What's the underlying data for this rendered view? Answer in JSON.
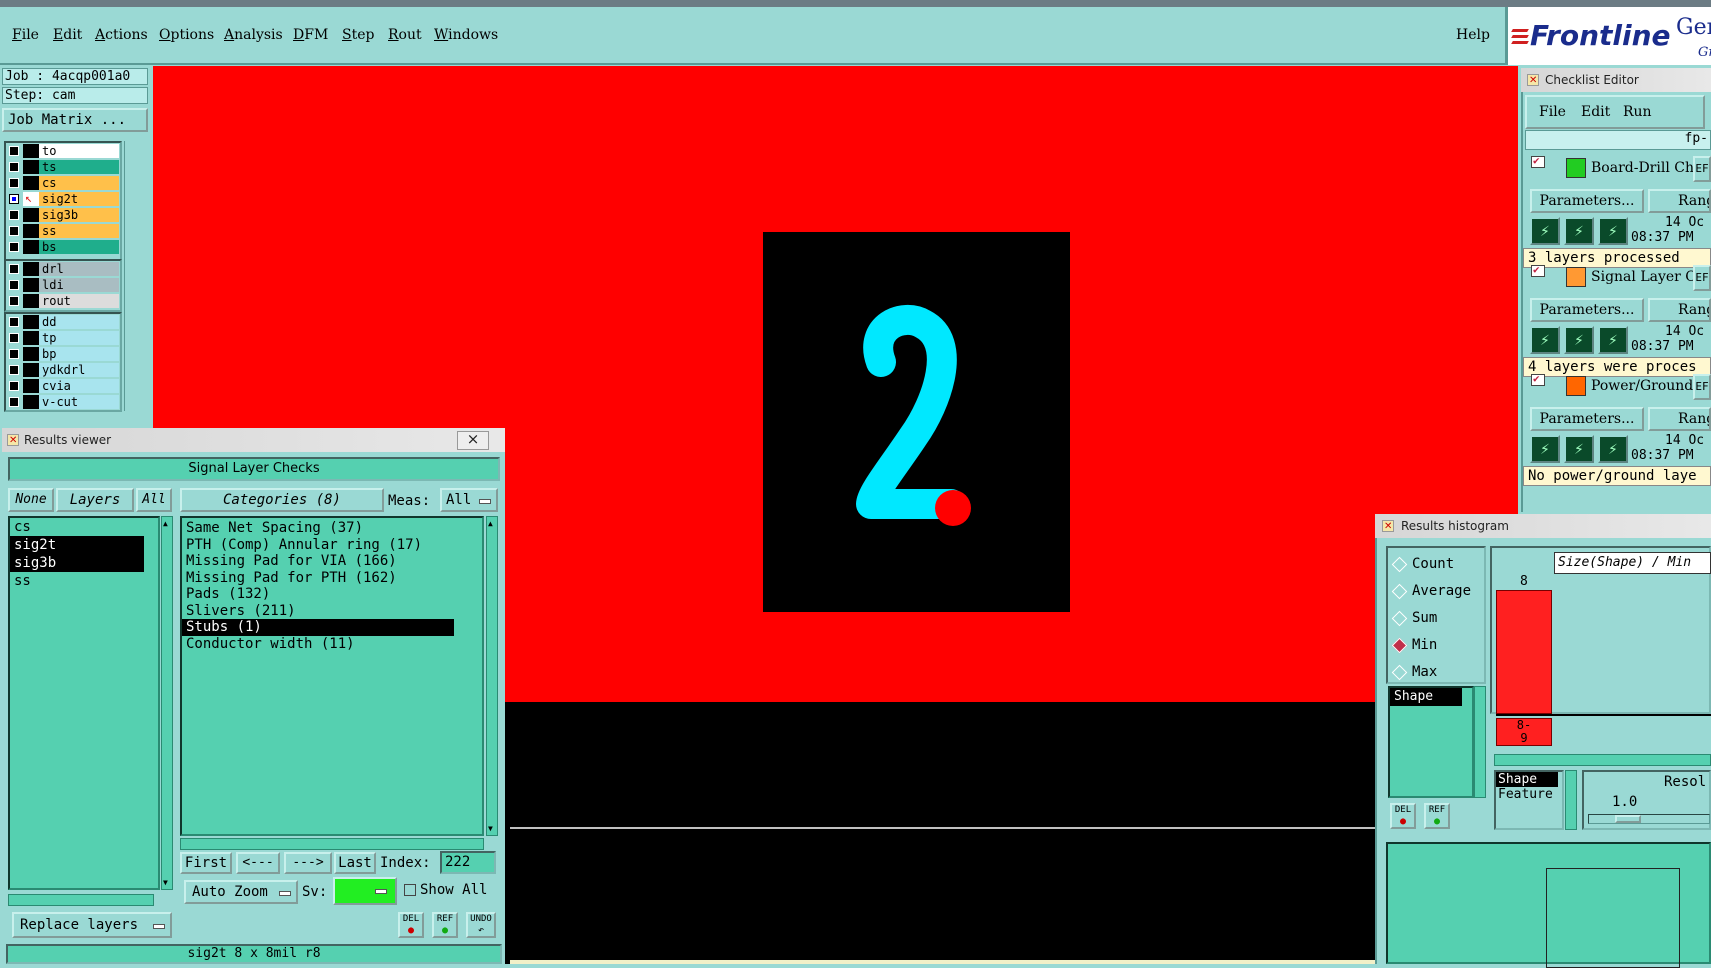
{
  "menubar": {
    "items": [
      {
        "label": "File",
        "u": "F"
      },
      {
        "label": "Edit",
        "u": "E"
      },
      {
        "label": "Actions",
        "u": "A"
      },
      {
        "label": "Options",
        "u": "O"
      },
      {
        "label": "Analysis",
        "u": "A"
      },
      {
        "label": "DFM",
        "u": "D"
      },
      {
        "label": "Step",
        "u": "S"
      },
      {
        "label": "Rout",
        "u": "R"
      },
      {
        "label": "Windows",
        "u": "W"
      }
    ],
    "help": "Help"
  },
  "brand": {
    "logo": "Frontline",
    "tail1": "Ger",
    "tail2": "Gr"
  },
  "job": {
    "job_line": "Job : 4acqp001a0",
    "step_line": "Step: cam",
    "matrix_button": "Job Matrix ..."
  },
  "layers": {
    "group1": [
      {
        "name": "to",
        "color": "#ffffff",
        "checked": false,
        "active": false
      },
      {
        "name": "ts",
        "color": "#1fae8c",
        "checked": false,
        "active": false
      },
      {
        "name": "cs",
        "color": "#ffc04a",
        "checked": false,
        "active": false
      },
      {
        "name": "sig2t",
        "color": "#ffc04a",
        "checked": true,
        "active": true
      },
      {
        "name": "sig3b",
        "color": "#ffc04a",
        "checked": false,
        "active": false
      },
      {
        "name": "ss",
        "color": "#ffc04a",
        "checked": false,
        "active": false
      },
      {
        "name": "bs",
        "color": "#1fae8c",
        "checked": false,
        "active": false
      }
    ],
    "group2": [
      {
        "name": "drl",
        "color": "#a9bdc2",
        "checked": false
      },
      {
        "name": "ldi",
        "color": "#a9bdc2",
        "checked": false
      },
      {
        "name": "rout",
        "color": "#dcdcdc",
        "checked": false
      }
    ],
    "group3": [
      {
        "name": "dd",
        "color": "#a8e4ee",
        "checked": false
      },
      {
        "name": "tp",
        "color": "#a8e4ee",
        "checked": false
      },
      {
        "name": "bp",
        "color": "#a8e4ee",
        "checked": false
      },
      {
        "name": "ydkdrl",
        "color": "#a8e4ee",
        "checked": false
      },
      {
        "name": "cvia",
        "color": "#a8e4ee",
        "checked": false
      },
      {
        "name": "v-cut",
        "color": "#a8e4ee",
        "checked": false
      }
    ]
  },
  "canvas": {
    "digit": "2",
    "colors": {
      "bg": "#ff0000",
      "box": "#000000",
      "digit": "#00e8ff",
      "pad": "#ff0000"
    }
  },
  "results_viewer": {
    "title": "Results viewer",
    "close": "×",
    "header": "Signal Layer Checks",
    "none_btn": "None",
    "layers_btn": "Layers",
    "all_btn": "All",
    "categories_btn": "Categories (8)",
    "meas_label": "Meas:",
    "meas_value": "All",
    "layer_list": [
      {
        "name": "cs",
        "sel": false
      },
      {
        "name": "sig2t",
        "sel": true
      },
      {
        "name": "sig3b",
        "sel": true
      },
      {
        "name": "ss",
        "sel": false
      }
    ],
    "categories": [
      {
        "name": "Same Net Spacing (37)",
        "sel": false
      },
      {
        "name": "PTH (Comp) Annular ring (17)",
        "sel": false
      },
      {
        "name": "Missing Pad for VIA (166)",
        "sel": false
      },
      {
        "name": "Missing Pad for PTH (162)",
        "sel": false
      },
      {
        "name": "Pads (132)",
        "sel": false
      },
      {
        "name": "Slivers (211)",
        "sel": false
      },
      {
        "name": "Stubs (1)",
        "sel": true
      },
      {
        "name": "Conductor width (11)",
        "sel": false
      }
    ],
    "first": "First",
    "prev": "<---",
    "next": "--->",
    "last": "Last",
    "index_label": "Index:",
    "index_value": "222",
    "auto_zoom": "Auto Zoom",
    "sv_label": "Sv:",
    "show_all": "Show All",
    "replace_layers": "Replace layers",
    "del": "DEL",
    "ref": "REF",
    "undo": "UNDO",
    "status": "sig2t 8 x 8mil  r8"
  },
  "checklist": {
    "title": "Checklist Editor",
    "menu": [
      "File",
      "Edit",
      "Run"
    ],
    "fp": "fp-",
    "items": [
      {
        "name": "Board-Drill Che",
        "tag": "EF",
        "params": "Parameters...",
        "range": "Range",
        "date": "14 Oc",
        "time": "08:37 PM",
        "status": "3 layers processed",
        "icon_color": "#22cc22"
      },
      {
        "name": "Signal Layer Ch",
        "tag": "EF",
        "params": "Parameters...",
        "range": "Range",
        "date": "14 Oc",
        "time": "08:37 PM",
        "status": "4 layers were proces",
        "icon_color": "#ff9933"
      },
      {
        "name": "Power/Ground C",
        "tag": "EF",
        "params": "Parameters...",
        "range": "Range",
        "date": "14 Oc",
        "time": "08:37 PM",
        "status": "No power/ground laye",
        "icon_color": "#ff6600"
      }
    ]
  },
  "histogram": {
    "title": "Results histogram",
    "options": [
      {
        "label": "Count",
        "on": false
      },
      {
        "label": "Average",
        "on": false
      },
      {
        "label": "Sum",
        "on": false
      },
      {
        "label": "Min",
        "on": true
      },
      {
        "label": "Max",
        "on": false
      }
    ],
    "axis_title": "Size(Shape) / Min",
    "shape_item": "Shape",
    "bar_value": "8",
    "bar_label_1": "8-",
    "bar_label_2": "9",
    "legend": [
      "Shape",
      "Feature"
    ],
    "resol_label": "Resol",
    "resol_value": "1.0",
    "del": "DEL",
    "ref": "REF",
    "bar_color": "#ff2020"
  }
}
